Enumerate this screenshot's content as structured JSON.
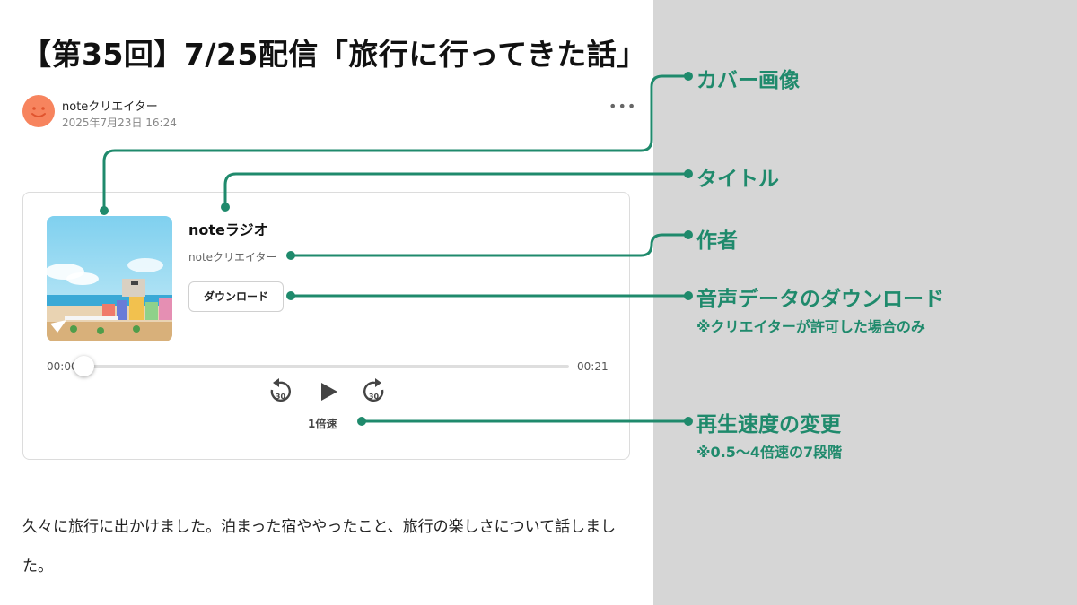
{
  "article": {
    "title": "【第35回】7/25配信「旅行に行ってきた話」",
    "author": "noteクリエイター",
    "date": "2025年7月23日 16:24",
    "more_label": "•••",
    "body": "久々に旅行に出かけました。泊まった宿ややったこと、旅行の楽しさについて話しました。"
  },
  "player": {
    "show_title": "noteラジオ",
    "show_author": "noteクリエイター",
    "download_label": "ダウンロード",
    "current_time": "00:00",
    "total_time": "00:21",
    "progress": 0,
    "skip_back_seconds": "30",
    "skip_forward_seconds": "30",
    "speed_label": "1倍速"
  },
  "annotations": {
    "cover": "カバー画像",
    "title": "タイトル",
    "author": "作者",
    "download": "音声データのダウンロード",
    "download_note": "※クリエイターが許可した場合のみ",
    "speed": "再生速度の変更",
    "speed_note": "※0.5〜4倍速の7段階"
  },
  "colors": {
    "annotation": "#1f8a6c",
    "avatar": "#f7845e",
    "backdrop": "#d6d6d6"
  },
  "icons": {
    "avatar": "smiley-face-icon",
    "more": "more-dots-icon",
    "play": "play-icon",
    "back": "rewind-30-icon",
    "forward": "forward-30-icon"
  }
}
